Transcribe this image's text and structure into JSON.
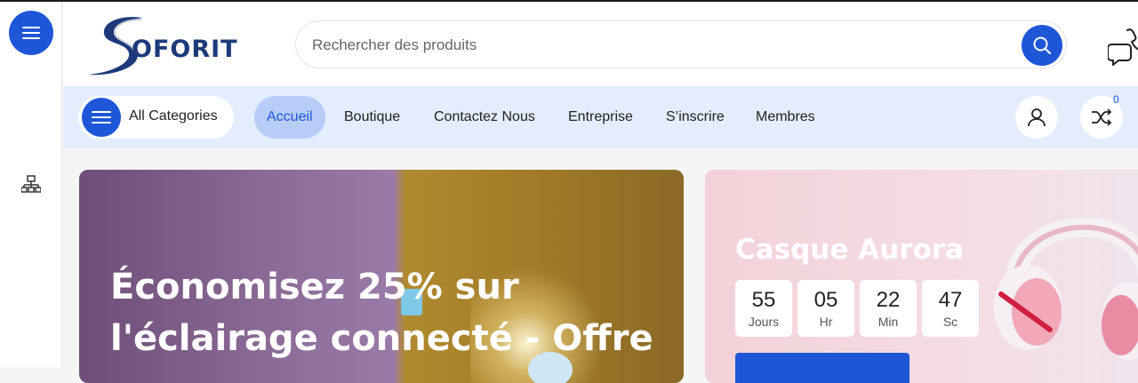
{
  "brand": {
    "logo_text": "OFORIT"
  },
  "search": {
    "placeholder": "Rechercher des produits"
  },
  "nav": {
    "all_categories": "All Categories",
    "items": [
      "Accueil",
      "Boutique",
      "Contactez Nous",
      "Entreprise",
      "S’inscrire",
      "Membres"
    ],
    "active": "Accueil",
    "compare_count": "0"
  },
  "hero": {
    "title": "Économisez 25% sur l'éclairage connecté - Offre"
  },
  "promo": {
    "title": "Casque Aurora",
    "countdown": [
      {
        "value": "55",
        "unit": "Jours"
      },
      {
        "value": "05",
        "unit": "Hr"
      },
      {
        "value": "22",
        "unit": "Min"
      },
      {
        "value": "47",
        "unit": "Sc"
      }
    ]
  },
  "colors": {
    "accent": "#1e56d8",
    "nav_bg": "#e3edfd",
    "active_pill": "#b7cdf7"
  },
  "icons": [
    "menu-icon",
    "sitemap-icon",
    "search-icon",
    "phone-chat-icon",
    "user-icon",
    "shuffle-compare-icon"
  ]
}
